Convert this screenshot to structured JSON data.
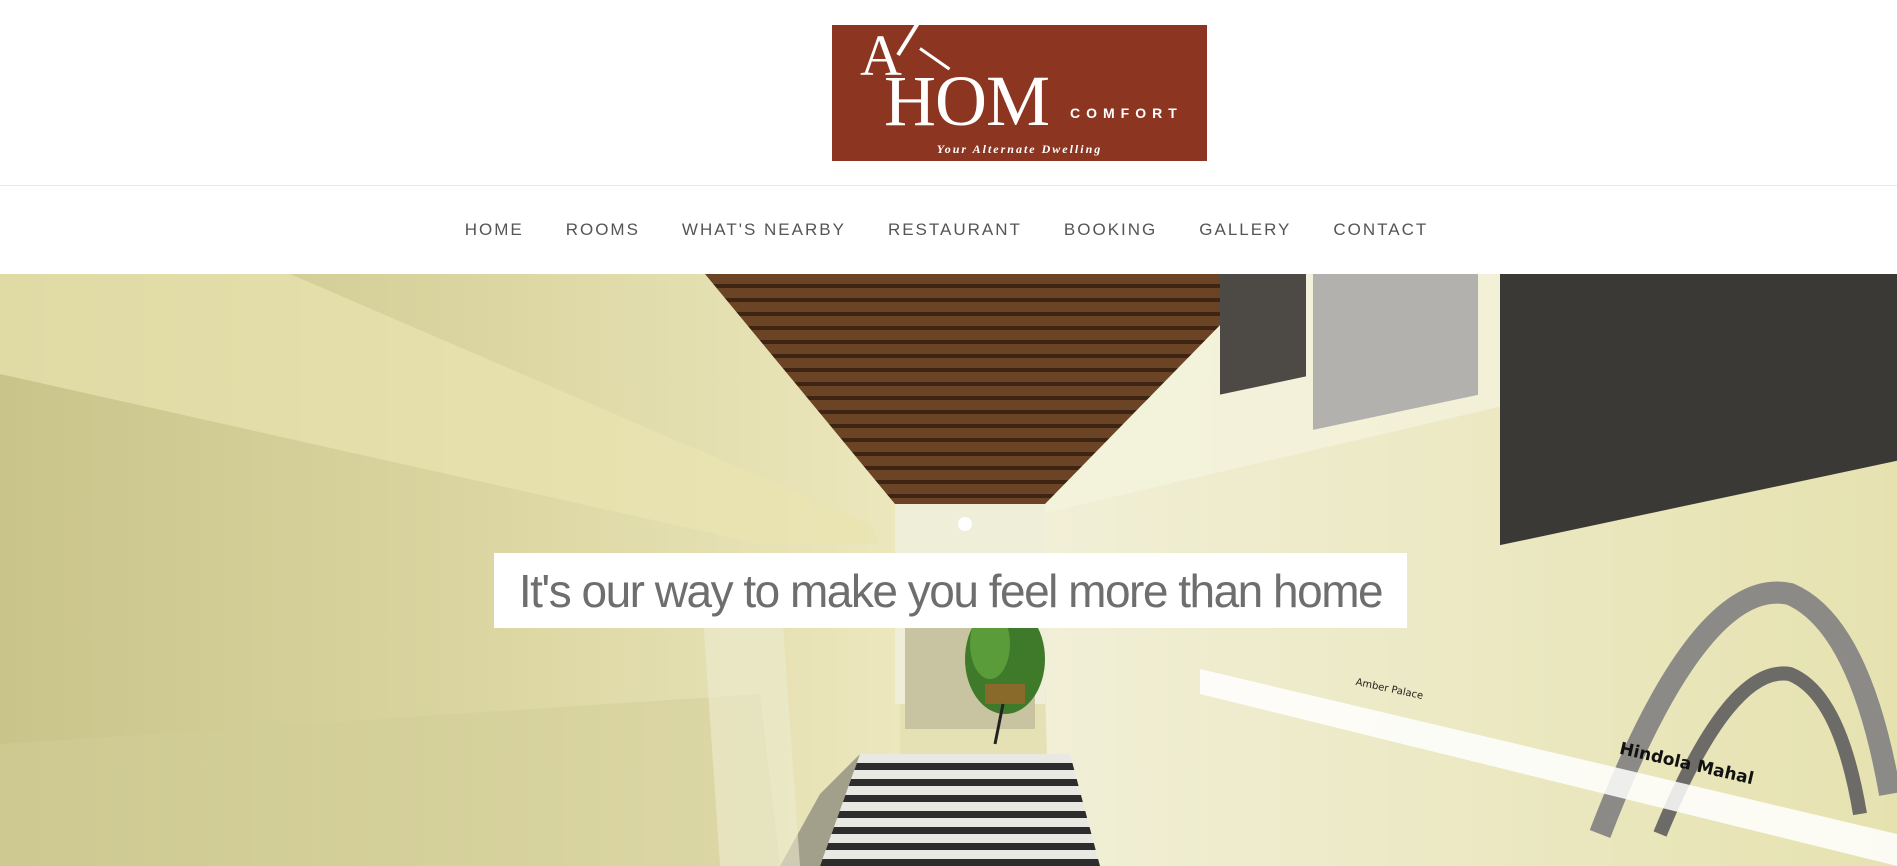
{
  "logo": {
    "letter_a": "A",
    "letters_hom": "HOM",
    "comfort": "COMFORT",
    "tagline": "Your Alternate Dwelling"
  },
  "nav": {
    "items": [
      {
        "label": "HOME"
      },
      {
        "label": "ROOMS"
      },
      {
        "label": "WHAT'S NEARBY"
      },
      {
        "label": "RESTAURANT"
      },
      {
        "label": "BOOKING"
      },
      {
        "label": "GALLERY"
      },
      {
        "label": "CONTACT"
      }
    ]
  },
  "hero": {
    "caption": "It's our way to make you feel more than home",
    "frame_labels": [
      "Amber Palace",
      "Hindola Mahal"
    ]
  },
  "colors": {
    "logo_bg": "#8c3621",
    "nav_text": "#555555",
    "caption_text": "#6e6e6e"
  }
}
